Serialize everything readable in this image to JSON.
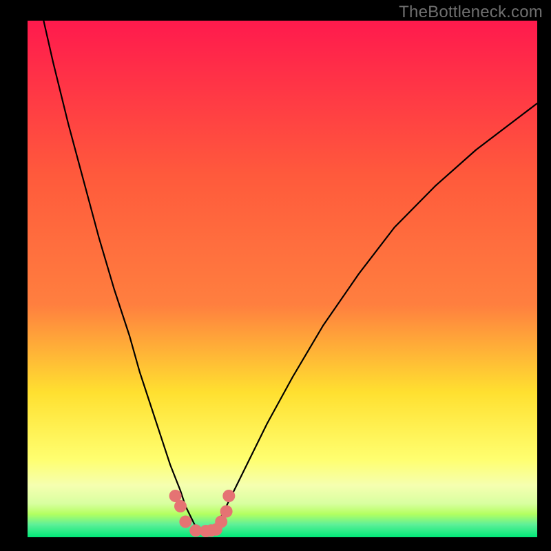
{
  "watermark": "TheBottleneck.com",
  "colors": {
    "frame": "#000000",
    "grad_top": "#ff1a4d",
    "grad_mid1": "#ff7f3f",
    "grad_mid2": "#ffe030",
    "grad_low": "#ffff70",
    "grad_bottom1": "#b4ff60",
    "grad_bottom2": "#00e878",
    "curve": "#000000",
    "marker": "#e57373"
  },
  "chart_data": {
    "type": "line",
    "title": "",
    "xlabel": "",
    "ylabel": "",
    "xlim": [
      0,
      100
    ],
    "ylim": [
      0,
      100
    ],
    "series": [
      {
        "name": "bottleneck-curve",
        "x": [
          0,
          2,
          5,
          8,
          11,
          14,
          17,
          20,
          22,
          24,
          26,
          28,
          30,
          31,
          32,
          33,
          34,
          35,
          36,
          37,
          38,
          40,
          43,
          47,
          52,
          58,
          65,
          72,
          80,
          88,
          96,
          100
        ],
        "y": [
          115,
          105,
          92,
          80,
          69,
          58,
          48,
          39,
          32,
          26,
          20,
          14,
          9,
          6,
          4,
          2,
          1.2,
          1,
          1.2,
          2,
          4,
          8,
          14,
          22,
          31,
          41,
          51,
          60,
          68,
          75,
          81,
          84
        ]
      }
    ],
    "markers": {
      "name": "highlighted-points",
      "x": [
        29,
        30,
        31,
        33,
        35,
        36,
        37,
        38,
        39,
        39.5
      ],
      "y": [
        8,
        6,
        3,
        1.3,
        1.2,
        1.3,
        1.5,
        3,
        5,
        8
      ]
    }
  }
}
